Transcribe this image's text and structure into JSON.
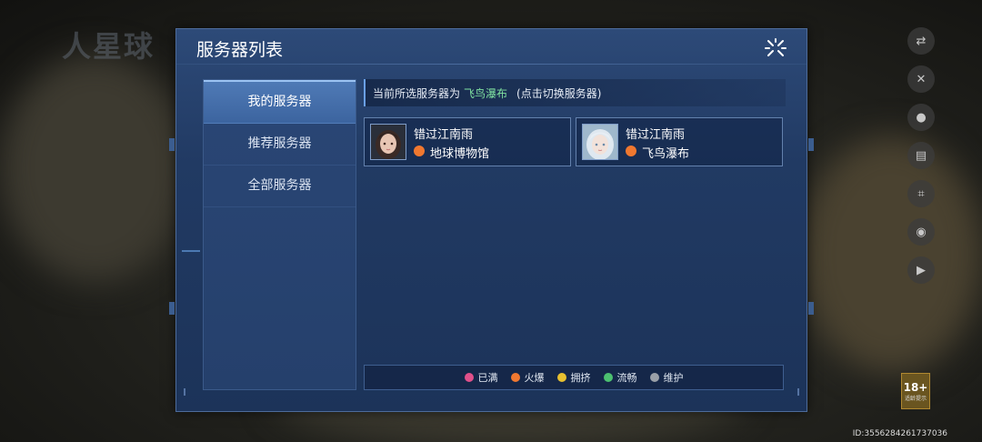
{
  "dialog": {
    "title": "服务器列表",
    "close_icon": "close-burst-icon"
  },
  "nav": {
    "items": [
      {
        "label": "我的服务器",
        "active": true
      },
      {
        "label": "推荐服务器",
        "active": false
      },
      {
        "label": "全部服务器",
        "active": false
      }
    ]
  },
  "current": {
    "prefix": "当前所选服务器为",
    "server": "飞鸟瀑布",
    "hint": "(点击切换服务器)"
  },
  "cards": [
    {
      "name": "错过江南雨",
      "server": "地球博物馆",
      "status_color": "#f07830",
      "avatar": "dark-haired-avatar"
    },
    {
      "name": "错过江南雨",
      "server": "飞鸟瀑布",
      "status_color": "#f07830",
      "avatar": "white-haired-avatar"
    }
  ],
  "legend": [
    {
      "label": "已满",
      "color": "#e0508a"
    },
    {
      "label": "火爆",
      "color": "#f07830"
    },
    {
      "label": "拥挤",
      "color": "#e8c030"
    },
    {
      "label": "流畅",
      "color": "#4cc070"
    },
    {
      "label": "维护",
      "color": "#9aa0a8"
    }
  ],
  "uid": "ID:3556284261737036",
  "age_rating": {
    "number": "18+",
    "caption": "适龄提示"
  },
  "side_icons": [
    "translate-icon",
    "tools-icon",
    "user-icon",
    "notice-icon",
    "scan-icon",
    "headset-icon",
    "video-icon"
  ]
}
